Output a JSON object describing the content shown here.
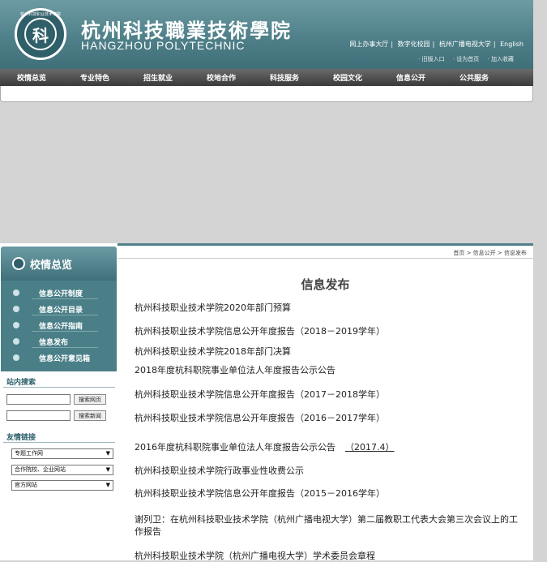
{
  "header": {
    "logo_text": "科",
    "logo_ring": "杭州科技职业技术学院",
    "school_name_cn": "杭州科技職業技術學院",
    "school_name_en": "HANGZHOU POLYTECHNIC",
    "top_links": [
      "网上办事大厅",
      "数字化校园",
      "杭州广播电视大学",
      "English"
    ],
    "sub_links": [
      "· 旧版入口",
      "· 设为首页",
      "· 加入收藏"
    ]
  },
  "nav": [
    "校情总览",
    "专业特色",
    "招生就业",
    "校地合作",
    "科技服务",
    "校园文化",
    "信息公开",
    "公共服务"
  ],
  "sidebar": {
    "title": "校情总览",
    "menu": [
      "信息公开制度",
      "信息公开目录",
      "信息公开指南",
      "信息发布",
      "信息公开意见箱"
    ],
    "search_title": "站内搜索",
    "search_btn1": "搜索网页",
    "search_btn2": "搜索新闻",
    "links_title": "友情链接",
    "selects": [
      "专题工作网",
      "合作院校、企业网站",
      "官方网站"
    ]
  },
  "main": {
    "breadcrumb": "首页 > 信息公开 > 信息发布",
    "title": "信息发布",
    "articles": [
      {
        "text": "杭州科技职业技术学院2020年部门预算"
      },
      {
        "text": "杭州科技职业技术学院信息公开年度报告（2018－2019学年）"
      },
      {
        "text": "杭州科技职业技术学院2018年部门决算"
      },
      {
        "text": "2018年度杭科职院事业单位法人年度报告公示公告"
      },
      {
        "text": "杭州科技职业技术学院信息公开年度报告（2017－2018学年）"
      },
      {
        "text": "杭州科技职业技术学院信息公开年度报告（2016－2017学年）"
      },
      {
        "text": "2016年度杭科职院事业单位法人年度报告公示公告",
        "date": "（2017.4）"
      },
      {
        "text": "杭州科技职业技术学院行政事业性收费公示"
      },
      {
        "text": "杭州科技职业技术学院信息公开年度报告（2015－2016学年）"
      },
      {
        "text": "谢列卫：在杭州科技职业技术学院（杭州广播电视大学）第二届教职工代表大会第三次会议上的工作报告"
      },
      {
        "text": "杭州科技职业技术学院（杭州广播电视大学）学术委员会章程"
      }
    ]
  }
}
